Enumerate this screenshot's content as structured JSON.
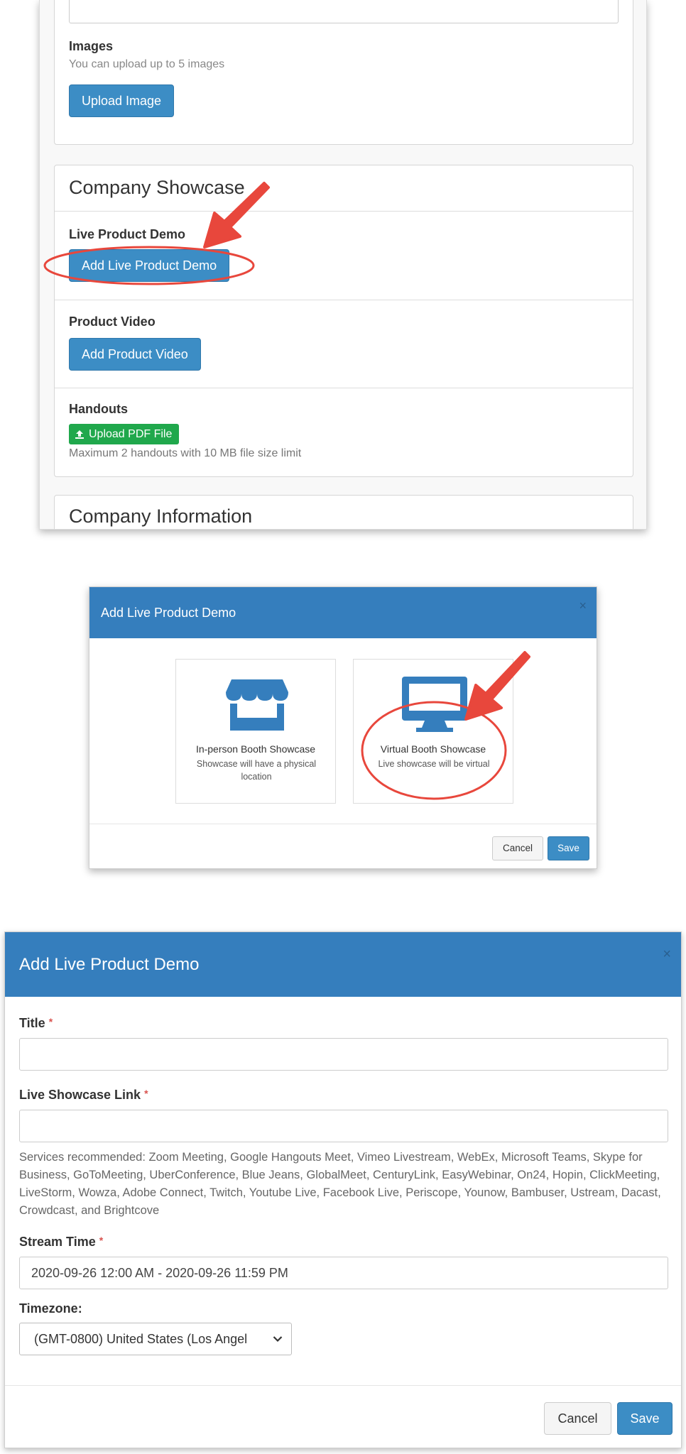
{
  "company_page": {
    "images": {
      "label": "Images",
      "help": "You can upload up to 5 images",
      "upload_button": "Upload Image"
    },
    "showcase": {
      "title": "Company Showcase",
      "live_demo_label": "Live Product Demo",
      "live_demo_button": "Add Live Product Demo",
      "video_label": "Product Video",
      "video_button": "Add Product Video",
      "handouts_label": "Handouts",
      "handouts_button": "Upload PDF File",
      "handouts_help": "Maximum 2 handouts with 10 MB file size limit"
    },
    "info_title": "Company Information"
  },
  "type_modal": {
    "title": "Add Live Product Demo",
    "close": "×",
    "options": [
      {
        "icon": "storefront-icon",
        "title": "In-person Booth Showcase",
        "desc": "Showcase will have a physical location"
      },
      {
        "icon": "monitor-icon",
        "title": "Virtual Booth Showcase",
        "desc": "Live showcase will be virtual"
      }
    ],
    "cancel": "Cancel",
    "save": "Save"
  },
  "form_modal": {
    "title": "Add Live Product Demo",
    "close": "×",
    "title_label": "Title",
    "title_value": "",
    "link_label": "Live Showcase Link",
    "link_value": "",
    "required_mark": "*",
    "services_help": "Services recommended: Zoom Meeting, Google Hangouts Meet, Vimeo Livestream, WebEx, Microsoft Teams, Skype for Business, GoToMeeting, UberConference, Blue Jeans, GlobalMeet, CenturyLink, EasyWebinar, On24, Hopin, ClickMeeting, LiveStorm, Wowza, Adobe Connect, Twitch, Youtube Live, Facebook Live, Periscope, Younow, Bambuser, Ustream, Dacast, Crowdcast, and Brightcove",
    "stream_label": "Stream Time",
    "stream_value": "2020-09-26 12:00 AM - 2020-09-26 11:59 PM",
    "timezone_label": "Timezone:",
    "timezone_value": "(GMT-0800) United States (Los Angel",
    "cancel": "Cancel",
    "save": "Save"
  },
  "colors": {
    "primary": "#3c8dc5",
    "modal_header": "#357ebd",
    "success": "#20a84c",
    "annotation": "#e8473c",
    "required": "#d9534f"
  }
}
